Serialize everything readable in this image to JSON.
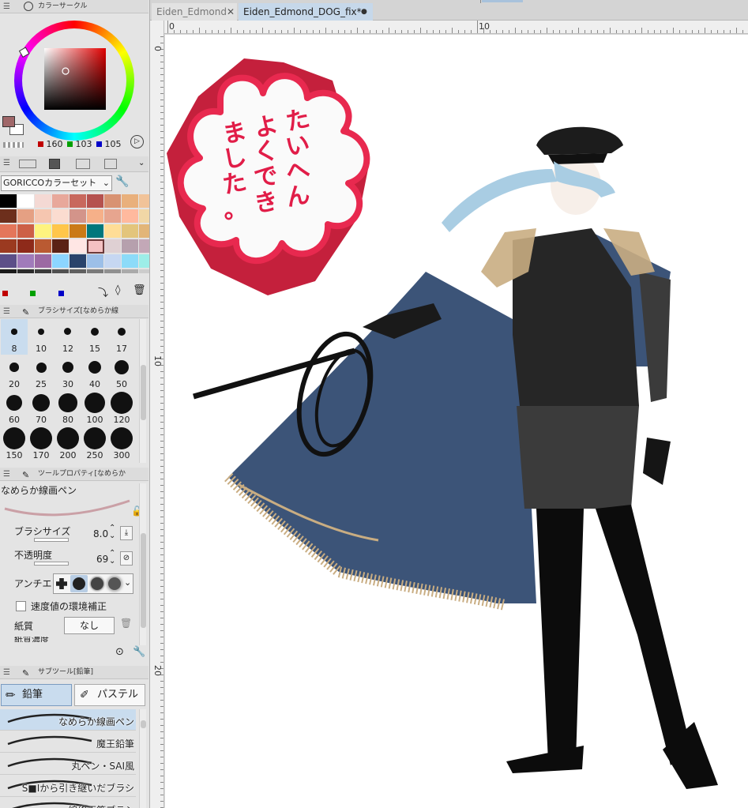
{
  "color_circle": {
    "title": "カラーサークル",
    "r": "160",
    "g": "103",
    "b": "105",
    "main_color": "#a06769",
    "sub_color": "#ffffff"
  },
  "color_set": {
    "selector": "GORICCOカラーセット",
    "swatches": [
      [
        "#000000",
        "#ffffff",
        "#f4d9d4",
        "#e8a89b",
        "#c8685d",
        "#b5524f",
        "#d89272",
        "#e9b07c",
        "#f1c399"
      ],
      [
        "#6d2f1c",
        "#e5a083",
        "#f6c6b0",
        "#fbdcd0",
        "#d3948a",
        "#f6b089",
        "#e7a58f",
        "#ffb99e",
        "#f1d7a6"
      ],
      [
        "#e4765a",
        "#cd6046",
        "#fef37f",
        "#ffc64a",
        "#ca7a17",
        "#00777c",
        "#ffdd96",
        "#e3c57c",
        "#e2b578"
      ],
      [
        "#9b3a20",
        "#8e2a1a",
        "#ba5a32",
        "#5a2215",
        "#ffe6e4",
        "#f4c1c2",
        "#dfd0d3",
        "#b6a0ad",
        "#c3a8b7"
      ],
      [
        "#5c4f88",
        "#a07bba",
        "#9c69a3",
        "#8cd5ff",
        "#2a436b",
        "#9cbfe8",
        "#c6d7f2",
        "#8cdbf9",
        "#9deee8"
      ],
      [
        "#1a1a1a",
        "#2a2a2a",
        "#3a3a3a",
        "#505050",
        "#606060",
        "#7a7a7a",
        "#909090",
        "#aaaaaa",
        "#cccccc"
      ]
    ]
  },
  "brush_size": {
    "title": "ブラシサイズ[なめらか線",
    "sizes": [
      "8",
      "10",
      "12",
      "15",
      "17",
      "20",
      "25",
      "30",
      "40",
      "50",
      "60",
      "70",
      "80",
      "100",
      "120",
      "150",
      "170",
      "200",
      "250",
      "300"
    ],
    "selected": "8"
  },
  "tool_property": {
    "title": "ツールプロパティ[なめらか",
    "tool_name": "なめらか線画ペン",
    "brush_size_label": "ブラシサイズ",
    "brush_size_value": "8.0",
    "opacity_label": "不透明度",
    "opacity_value": "69",
    "antialias_label": "アンチエ",
    "speed_correction_label": "速度値の環境補正",
    "paper_label": "紙質",
    "paper_value": "なし",
    "paper_density_label": "紙質濃度"
  },
  "subtool": {
    "title": "サブツール[鉛筆]",
    "group_pencil": "鉛筆",
    "group_pastel": "パステル",
    "items": [
      "なめらか線画ペン",
      "魔王鉛筆",
      "丸ペン・SAI風",
      "S■Iから引き継いだブラシ",
      "線修正筆ブラシ"
    ],
    "selected_index": 0
  },
  "tabs": [
    "Eiden_Edmond",
    "Eiden_Edmond_DOG_fix*"
  ],
  "ruler": {
    "top": [
      "0",
      "10"
    ],
    "left": [
      "0",
      "10",
      "20"
    ]
  },
  "stamp": {
    "text_columns": [
      "たいへん",
      "よくでき",
      "ました。"
    ],
    "text_color": "#e11d48",
    "outline_color": "#e8294f",
    "shadow_color": "#c4203c"
  },
  "artwork": {
    "coat_color": "#3c5478",
    "fringe_color": "#c9ad82",
    "hair_color": "#a9cde3"
  }
}
